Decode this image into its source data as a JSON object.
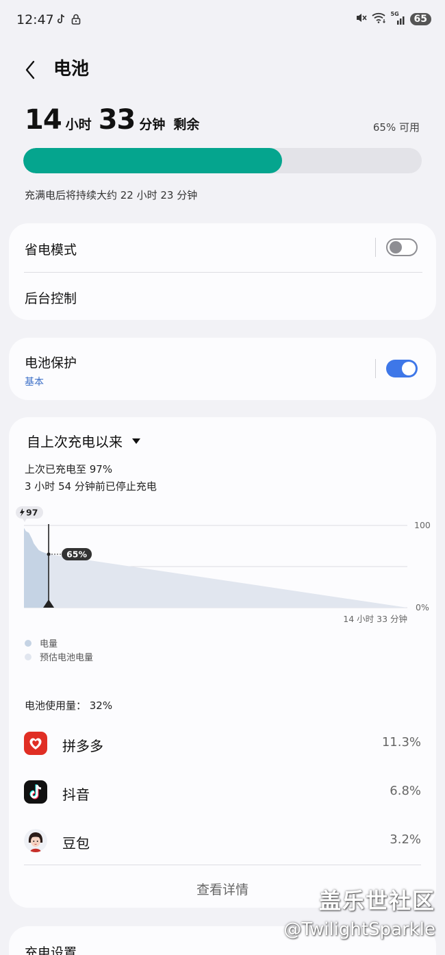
{
  "status_bar": {
    "time": "12:47",
    "battery": "65",
    "network": "5G"
  },
  "header": {
    "title": "电池"
  },
  "summary": {
    "hours": "14",
    "hours_unit": "小时",
    "minutes": "33",
    "minutes_unit": "分钟",
    "remain_word": "剩余",
    "available": "65% 可用",
    "level_fraction": 0.65,
    "full_charge_note": "充满电后将持续大约 22 小时 23 分钟",
    "bar_color": "#05a58e"
  },
  "settings_card": {
    "power_saving_label": "省电模式",
    "power_saving_on": false,
    "background_control_label": "后台控制"
  },
  "protection_card": {
    "label": "电池保护",
    "sub_label": "基本",
    "enabled": true,
    "toggle_color": "#3e77e8"
  },
  "usage_card": {
    "period_label": "自上次充电以来",
    "last_charged": "上次已充电至 97%",
    "stopped_charging": "3 小时 54 分钟前已停止充电",
    "chart_data": {
      "type": "area",
      "start_badge": "97",
      "current_badge": "65%",
      "y_top_label": "100",
      "y_bottom_label": "0%",
      "x_end_label": "14 小时 33 分钟",
      "ylim": [
        0,
        100
      ],
      "grid": true,
      "series": [
        {
          "name": "电量",
          "color": "#c5d3e4",
          "x": [
            0,
            0.08,
            0.2,
            0.32,
            0.4,
            0.5,
            0.6,
            0.72,
            1.0
          ],
          "values": [
            97,
            93,
            91,
            84,
            78,
            74,
            70,
            68,
            65
          ]
        },
        {
          "name": "预估电池电量",
          "color": "#e1e6ef",
          "x": [
            1.0,
            15.53
          ],
          "values": [
            65,
            0
          ]
        }
      ]
    },
    "legend": {
      "actual": "电量",
      "estimated": "预估电池电量"
    },
    "usage_total": "电池使用量：  32%",
    "apps": [
      {
        "name": "拼多多",
        "percent": "11.3%",
        "icon": "pinduoduo-icon"
      },
      {
        "name": "抖音",
        "percent": "6.8%",
        "icon": "douyin-icon"
      },
      {
        "name": "豆包",
        "percent": "3.2%",
        "icon": "doubao-icon"
      }
    ],
    "details_button": "查看详情"
  },
  "charging_settings_label": "充电设置",
  "watermark": {
    "site": "盖乐世社区",
    "handle": "@TwilightSparkle"
  }
}
